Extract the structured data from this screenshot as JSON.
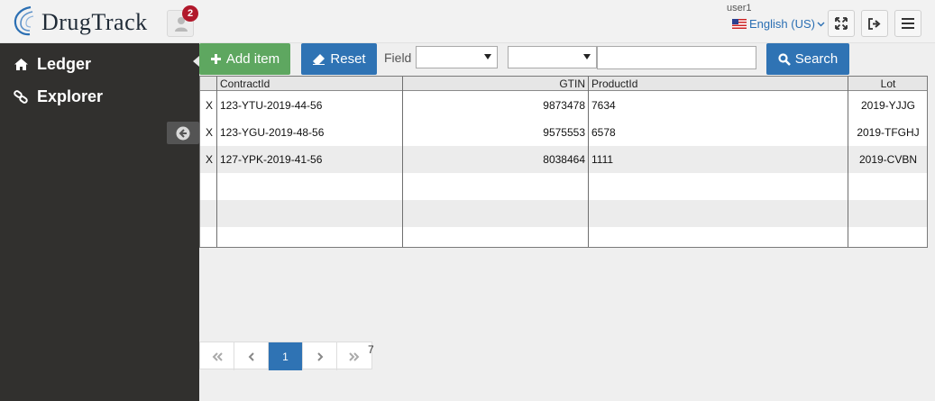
{
  "header": {
    "brand": "DrugTrack",
    "badge_count": "2",
    "username": "user1",
    "language": "English (US)"
  },
  "sidebar": {
    "items": [
      {
        "label": "Ledger",
        "icon": "home-icon"
      },
      {
        "label": "Explorer",
        "icon": "link-icon"
      }
    ]
  },
  "toolbar": {
    "add_label": "Add item",
    "reset_label": "Reset",
    "field_label": "Field",
    "search_label": "Search",
    "search_value": ""
  },
  "table": {
    "columns": [
      "",
      "ContractId",
      "GTIN",
      "ProductId",
      "Lot"
    ],
    "rows": [
      [
        "X",
        "123-YTU-2019-44-56",
        "9873478",
        "7634",
        "2019-YJJG"
      ],
      [
        "X",
        "123-YGU-2019-48-56",
        "9575553",
        "6578",
        "2019-TFGHJ"
      ],
      [
        "X",
        "127-YPK-2019-41-56",
        "8038464",
        "1111",
        "2019-CVBN"
      ]
    ]
  },
  "pager": {
    "current_page": "1",
    "total": "7"
  },
  "colors": {
    "sidebar_bg": "#31302e",
    "add_green": "#5ea760",
    "primary_blue": "#2f73b4",
    "badge_red": "#b1182b"
  }
}
